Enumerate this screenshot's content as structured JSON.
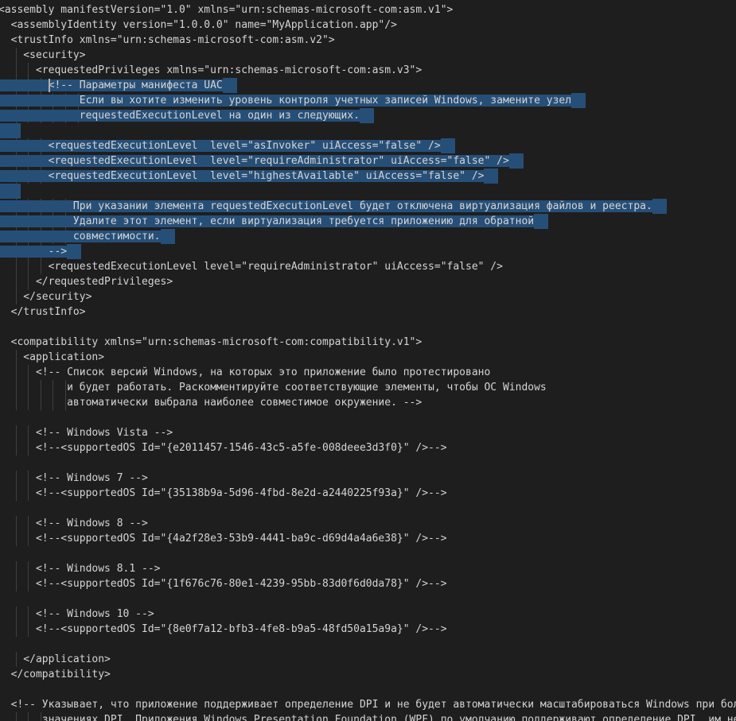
{
  "editor": {
    "language": "xml",
    "colors": {
      "background": "#1e1e1e",
      "text": "#d4d4d4",
      "selection": "#264f78",
      "indent_guide": "#404040"
    },
    "lines": [
      "<assembly manifestVersion=\"1.0\" xmlns=\"urn:schemas-microsoft-com:asm.v1\">",
      "  <assemblyIdentity version=\"1.0.0.0\" name=\"MyApplication.app\"/>",
      "  <trustInfo xmlns=\"urn:schemas-microsoft-com:asm.v2\">",
      "    <security>",
      "      <requestedPrivileges xmlns=\"urn:schemas-microsoft-com:asm.v3\">",
      "        <!-- Параметры манифеста UAC",
      "             Если вы хотите изменить уровень контроля учетных записей Windows, замените узел",
      "             requestedExecutionLevel на один из следующих.",
      "",
      "        <requestedExecutionLevel  level=\"asInvoker\" uiAccess=\"false\" />",
      "        <requestedExecutionLevel  level=\"requireAdministrator\" uiAccess=\"false\" />",
      "        <requestedExecutionLevel  level=\"highestAvailable\" uiAccess=\"false\" />",
      "",
      "            При указании элемента requestedExecutionLevel будет отключена виртуализация файлов и реестра.",
      "            Удалите этот элемент, если виртуализация требуется приложению для обратной",
      "            совместимости.",
      "        -->",
      "        <requestedExecutionLevel level=\"requireAdministrator\" uiAccess=\"false\" />",
      "      </requestedPrivileges>",
      "    </security>",
      "  </trustInfo>",
      "",
      "  <compatibility xmlns=\"urn:schemas-microsoft-com:compatibility.v1\">",
      "    <application>",
      "      <!-- Список версий Windows, на которых это приложение было протестировано",
      "           и будет работать. Раскомментируйте соответствующие элементы, чтобы ОС Windows",
      "           автоматически выбрала наиболее совместимое окружение. -->",
      "",
      "      <!-- Windows Vista -->",
      "      <!--<supportedOS Id=\"{e2011457-1546-43c5-a5fe-008deee3d3f0}\" />-->",
      "",
      "      <!-- Windows 7 -->",
      "      <!--<supportedOS Id=\"{35138b9a-5d96-4fbd-8e2d-a2440225f93a}\" />-->",
      "",
      "      <!-- Windows 8 -->",
      "      <!--<supportedOS Id=\"{4a2f28e3-53b9-4441-ba9c-d69d4a4a6e38}\" />-->",
      "",
      "      <!-- Windows 8.1 -->",
      "      <!--<supportedOS Id=\"{1f676c76-80e1-4239-95bb-83d0f6d0da78}\" />-->",
      "",
      "      <!-- Windows 10 -->",
      "      <!--<supportedOS Id=\"{8e0f7a12-bfb3-4fe8-b9a5-48fd50a15a9a}\" />-->",
      "",
      "    </application>",
      "  </compatibility>",
      "",
      "  <!-- Указывает, что приложение поддерживает определение DPI и не будет автоматически масштабироваться Windows при более высоких",
      "       значениях DPI. Приложения Windows Presentation Foundation (WPF) по умолчанию поддерживают определение DPI, им не нужно"
    ],
    "selected_line_indexes": [
      5,
      6,
      7,
      8,
      9,
      10,
      11,
      12,
      13,
      14,
      15,
      16
    ]
  }
}
